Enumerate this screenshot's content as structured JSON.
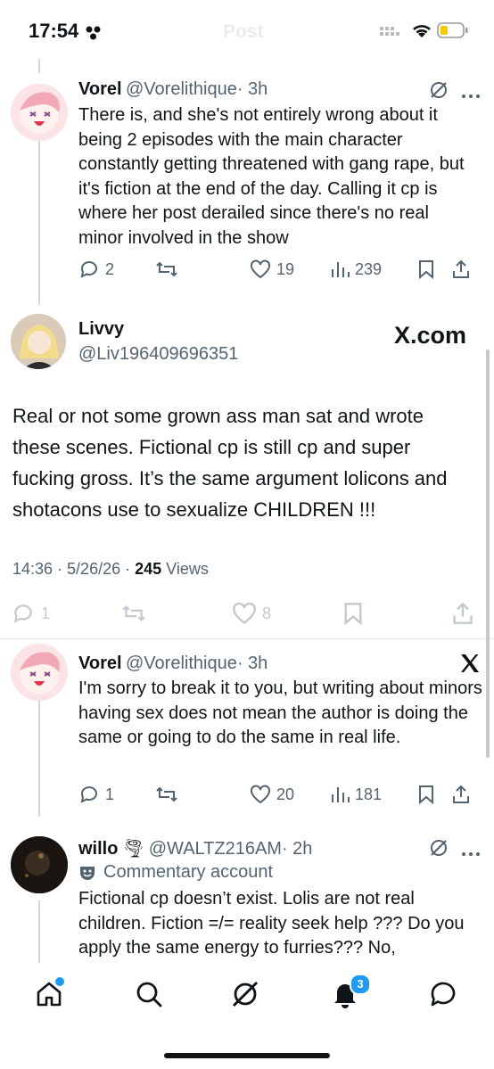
{
  "status": {
    "time": "17:54",
    "ghost_title": "Post"
  },
  "reply1": {
    "name": "Vorel",
    "handle": "@Vorelithique",
    "sep_time": "· 3h",
    "text": "There is, and she's not entirely wrong about it being 2 episodes with the main character constantly getting threatened with gang rape, but it's fiction at the end of the day. Calling it cp is where her post derailed since there's no real minor involved in the show",
    "replies": "2",
    "likes": "19",
    "views": "239"
  },
  "quote": {
    "name": "Livvy",
    "handle": "@Liv196409696351",
    "brand": "X.com",
    "text": "Real or not some grown ass man sat and wrote these scenes. Fictional cp is still cp and super fucking gross. It’s the same argument lolicons and shotacons use to sexualize CHILDREN !!!",
    "time": "14:36 · 5/26/26 · ",
    "views_count": "245",
    "views_label": " Views",
    "replies": "1",
    "likes": "8"
  },
  "reply2": {
    "name": "Vorel",
    "handle": "@Vorelithique",
    "sep_time": "· 3h",
    "text": "I'm sorry to break it to you, but writing about minors having sex does not mean the author is doing the same or going to do the same in real life.",
    "replies": "1",
    "likes": "20",
    "views": "181"
  },
  "reply3": {
    "name": "willo",
    "emoji": "🌪",
    "handle": "@WALTZ216AM",
    "sep_time": "· 2h",
    "label": "Commentary account",
    "text": "Fictional cp doesn’t exist. Lolis are not real children. Fiction =/= reality seek help ??? Do you apply the same energy to furries??? No,"
  },
  "tabbar": {
    "notifications_badge": "3"
  },
  "colors": {
    "accent": "#1d9bf0",
    "text": "#0f1419",
    "muted": "#536471"
  }
}
